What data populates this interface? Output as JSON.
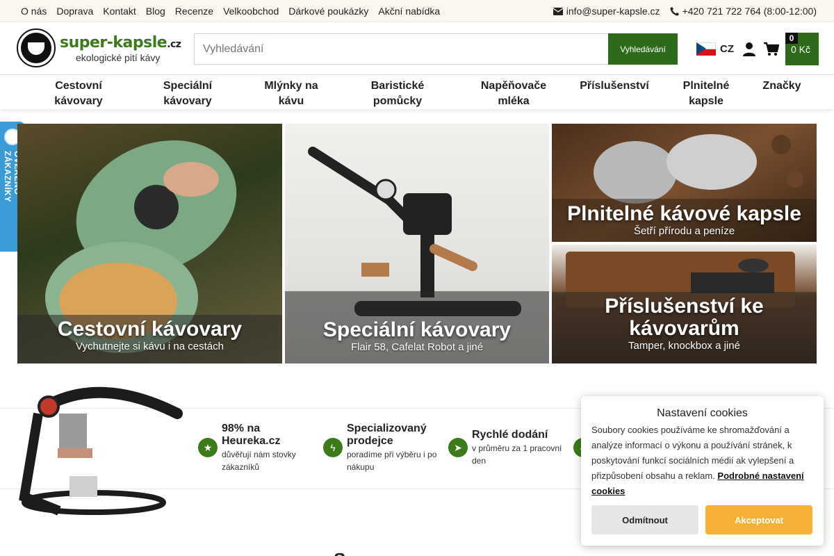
{
  "topbar": {
    "links": [
      "O nás",
      "Doprava",
      "Kontakt",
      "Blog",
      "Recenze",
      "Velkoobchod",
      "Dárkové poukázky",
      "Akční nabídka"
    ],
    "email": "info@super-kapsle.cz",
    "phone": "+420 721 722 764 (8:00-12:00)"
  },
  "header": {
    "logo_name": "super-kapsle",
    "logo_tld": ".cz",
    "logo_tagline": "ekologické pití kávy",
    "search_placeholder": "Vyhledávání",
    "search_button": "Vyhledávání",
    "lang": "CZ",
    "cart_count": "0",
    "cart_price": "0 Kč"
  },
  "nav": [
    "Cestovní kávovary",
    "Speciální kávovary",
    "Mlýnky na kávu",
    "Baristické pomůcky",
    "Napěňovače mléka",
    "Příslušenství",
    "Plnitelné kapsle",
    "Značky"
  ],
  "banners": [
    {
      "title": "Cestovní kávovary",
      "subtitle": "Vychutnejte si kávu i na cestách"
    },
    {
      "title": "Speciální kávovary",
      "subtitle": "Flair 58, Cafelat Robot a jiné"
    },
    {
      "title": "Plnitelné kávové kapsle",
      "subtitle": "Šetří přírodu a peníze"
    },
    {
      "title": "Příslušenství ke kávovarům",
      "subtitle": "Tamper, knockbox a jiné"
    }
  ],
  "side_badge": "OVĚŘENO ZÁKAZNÍKY",
  "features": [
    {
      "title": "98% na Heureka.cz",
      "subtitle": "důvěřují nám stovky zákazníků",
      "icon": "star-icon"
    },
    {
      "title": "Specializovaný prodejce",
      "subtitle": "poradíme při výběru i po nákupu",
      "icon": "bolt-icon"
    },
    {
      "title": "Rychlé dodání",
      "subtitle": "v průměru za 1 pracovní den",
      "icon": "send-icon"
    }
  ],
  "cookie": {
    "title": "Nastavení cookies",
    "text": "Soubory cookies používáme ke shromažďování a analýze informací o výkonu a používání stránek, k poskytování funkcí sociálních médií ak vylepšení a přizpůsobení obsahu a reklam.",
    "link": "Podrobné nastavení cookies",
    "reject": "Odmítnout",
    "accept": "Akceptovat"
  },
  "bottom_heading": "Se..."
}
